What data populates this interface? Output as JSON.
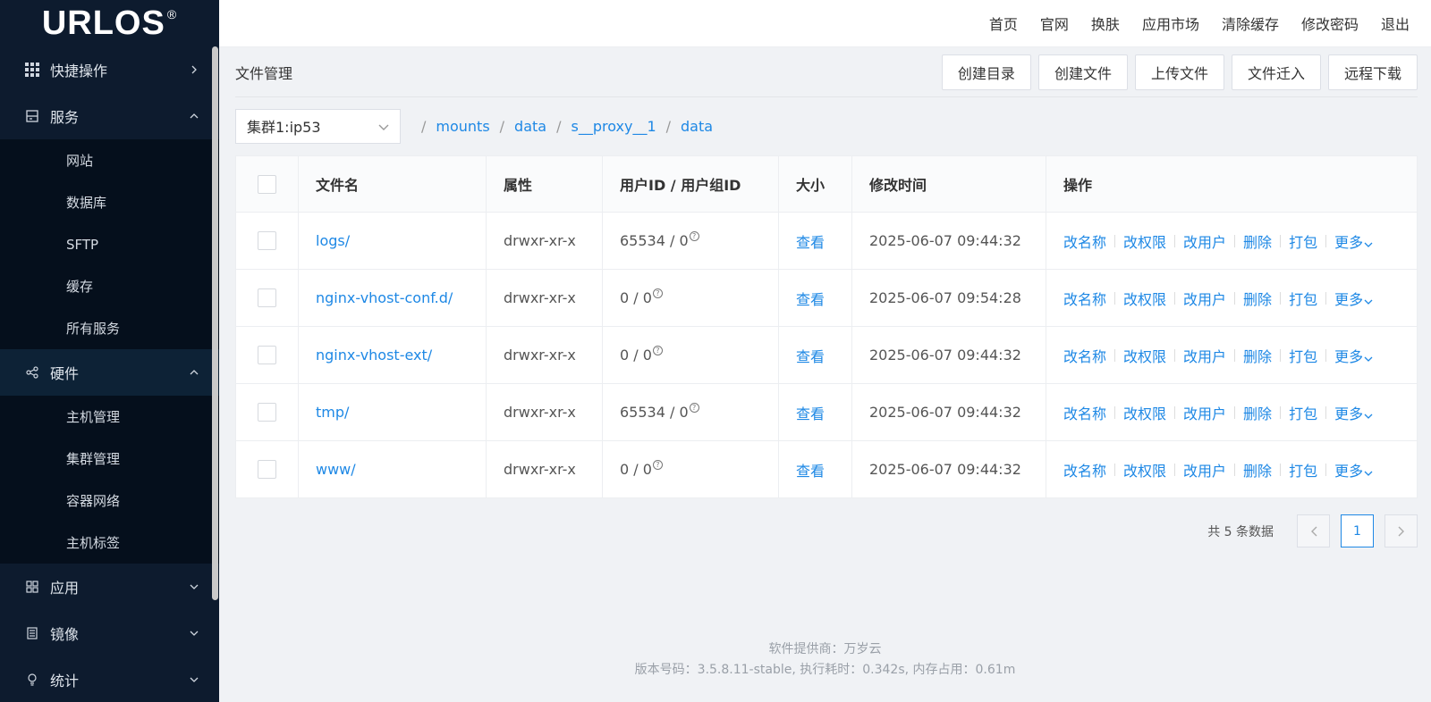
{
  "brand": {
    "name": "URLOS",
    "reg": "®"
  },
  "sidebar": {
    "groups": [
      {
        "label": "快捷操作",
        "icon": "grid-icon",
        "expanded": false,
        "items": []
      },
      {
        "label": "服务",
        "icon": "server-icon",
        "expanded": true,
        "items": [
          {
            "label": "网站"
          },
          {
            "label": "数据库"
          },
          {
            "label": "SFTP"
          },
          {
            "label": "缓存"
          },
          {
            "label": "所有服务"
          }
        ]
      },
      {
        "label": "硬件",
        "icon": "share-icon",
        "expanded": true,
        "items": [
          {
            "label": "主机管理"
          },
          {
            "label": "集群管理"
          },
          {
            "label": "容器网络"
          },
          {
            "label": "主机标签"
          }
        ]
      },
      {
        "label": "应用",
        "icon": "apps-icon",
        "expanded": false,
        "items": []
      },
      {
        "label": "镜像",
        "icon": "image-icon",
        "expanded": false,
        "items": []
      },
      {
        "label": "统计",
        "icon": "bulb-icon",
        "expanded": false,
        "items": []
      }
    ]
  },
  "topnav": {
    "items": [
      "首页",
      "官网",
      "换肤",
      "应用市场",
      "清除缓存",
      "修改密码",
      "退出"
    ]
  },
  "page": {
    "title": "文件管理",
    "toolbar": [
      "创建目录",
      "创建文件",
      "上传文件",
      "文件迁入",
      "远程下载"
    ]
  },
  "cluster_select": {
    "value": "集群1:ip53"
  },
  "breadcrumb": [
    "mounts",
    "data",
    "s__proxy__1",
    "data"
  ],
  "table": {
    "headers": [
      "文件名",
      "属性",
      "用户ID / 用户组ID",
      "大小",
      "修改时间",
      "操作"
    ],
    "rows": [
      {
        "name": "logs/",
        "attr": "drwxr-xr-x",
        "ids": "65534 / 0",
        "size": "查看",
        "mtime": "2025-06-07 09:44:32"
      },
      {
        "name": "nginx-vhost-conf.d/",
        "attr": "drwxr-xr-x",
        "ids": "0 / 0",
        "size": "查看",
        "mtime": "2025-06-07 09:54:28"
      },
      {
        "name": "nginx-vhost-ext/",
        "attr": "drwxr-xr-x",
        "ids": "0 / 0",
        "size": "查看",
        "mtime": "2025-06-07 09:44:32"
      },
      {
        "name": "tmp/",
        "attr": "drwxr-xr-x",
        "ids": "65534 / 0",
        "size": "查看",
        "mtime": "2025-06-07 09:44:32"
      },
      {
        "name": "www/",
        "attr": "drwxr-xr-x",
        "ids": "0 / 0",
        "size": "查看",
        "mtime": "2025-06-07 09:44:32"
      }
    ],
    "ops": [
      "改名称",
      "改权限",
      "改用户",
      "删除",
      "打包",
      "更多"
    ]
  },
  "pagination": {
    "total": "共 5 条数据",
    "current": "1"
  },
  "footer": {
    "line1": "软件提供商：万岁云",
    "line2": "版本号码：3.5.8.11-stable,   执行耗时：0.342s,   内存占用：0.61m"
  },
  "colors": {
    "sidebar_bg": "#0d1b2e",
    "link": "#1e88e5",
    "page_bg": "#f0f2f5"
  }
}
